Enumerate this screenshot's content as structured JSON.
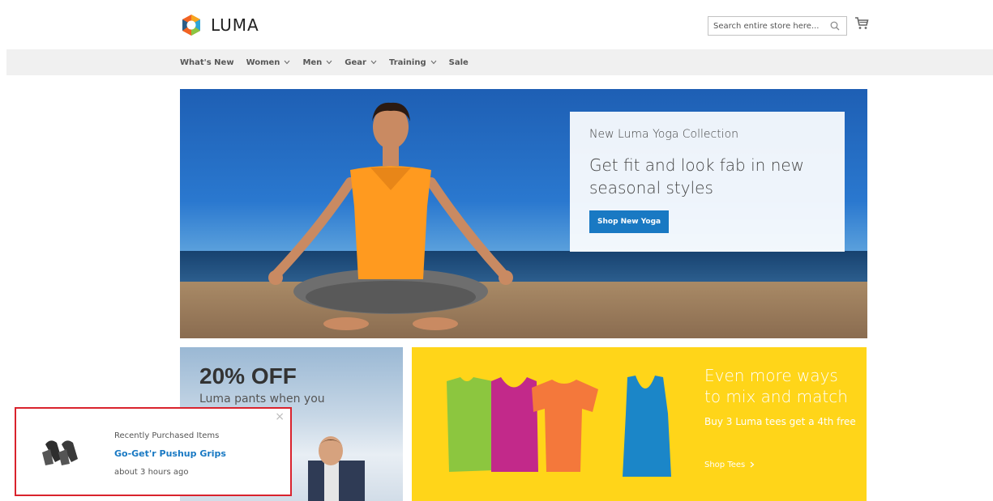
{
  "header": {
    "logo_text": "LUMA",
    "search_placeholder": "Search entire store here...",
    "icons": {
      "search": "search-icon",
      "cart": "cart-icon",
      "logo": "luma-logo-icon"
    }
  },
  "nav": {
    "items": [
      {
        "label": "What's New",
        "has_dropdown": false
      },
      {
        "label": "Women",
        "has_dropdown": true
      },
      {
        "label": "Men",
        "has_dropdown": true
      },
      {
        "label": "Gear",
        "has_dropdown": true
      },
      {
        "label": "Training",
        "has_dropdown": true
      },
      {
        "label": "Sale",
        "has_dropdown": false
      }
    ]
  },
  "hero": {
    "kicker": "New Luma Yoga Collection",
    "title": "Get fit and look fab in new seasonal styles",
    "button_label": "Shop New Yoga"
  },
  "promo_left": {
    "headline": "20% OFF",
    "subtext": "Luma pants when you"
  },
  "promo_right": {
    "title": "Even more ways to mix and match",
    "subtext": "Buy 3 Luma tees get a 4th free",
    "link_label": "Shop Tees",
    "link_icon": "chevron-right-icon"
  },
  "popup": {
    "label": "Recently Purchased Items",
    "product_name": "Go-Get'r Pushup Grips",
    "time": "about 3 hours ago",
    "close_symbol": "×"
  },
  "colors": {
    "accent": "#1979c3",
    "nav_bg": "#f0f0f0",
    "promo_yellow": "#ffd519",
    "popup_border": "#d9232d"
  }
}
